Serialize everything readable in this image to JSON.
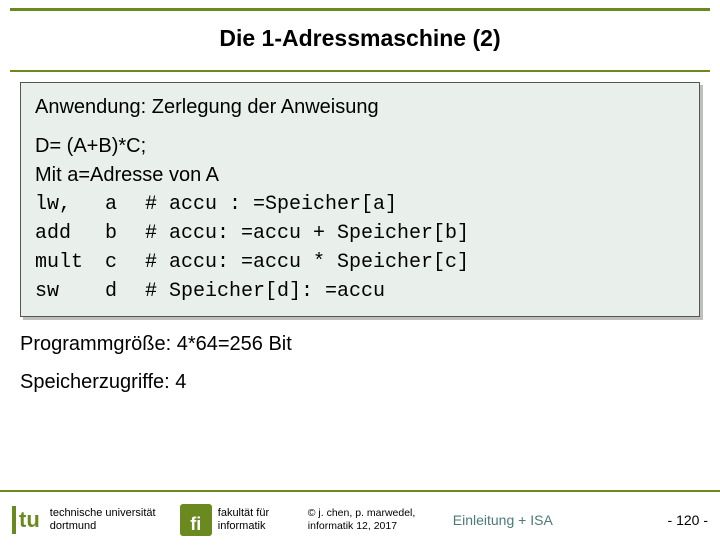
{
  "title": "Die 1-Adressmaschine (2)",
  "app_title": "Anwendung: Zerlegung der Anweisung",
  "expr": "D= (A+B)*C;",
  "addr_note": "Mit a=Adresse von A",
  "code": [
    {
      "op": "lw,",
      "arg": "a",
      "cmt": "# accu : =Speicher[a]"
    },
    {
      "op": "add",
      "arg": "b",
      "cmt": "# accu: =accu + Speicher[b]"
    },
    {
      "op": "mult",
      "arg": "c",
      "cmt": "# accu: =accu * Speicher[c]"
    },
    {
      "op": "sw",
      "arg": "d",
      "cmt": "# Speicher[d]: =accu"
    }
  ],
  "program_size": "Programmgröße: 4*64=256 Bit",
  "mem_access": "Speicherzugriffe: 4",
  "footer": {
    "tu": "tu",
    "university": "technische universität dortmund",
    "fi": "fi",
    "faculty": "fakultät für informatik",
    "credits": "© j. chen, p. marwedel, informatik 12, 2017",
    "lecture": "Einleitung + ISA",
    "page": "- 120 -"
  }
}
